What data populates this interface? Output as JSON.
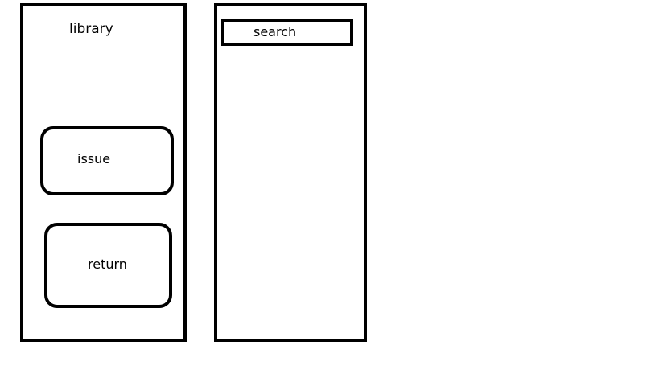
{
  "left_panel": {
    "title": "library",
    "buttons": {
      "issue": "issue",
      "return": "return"
    }
  },
  "right_panel": {
    "search": {
      "label": "search"
    }
  }
}
